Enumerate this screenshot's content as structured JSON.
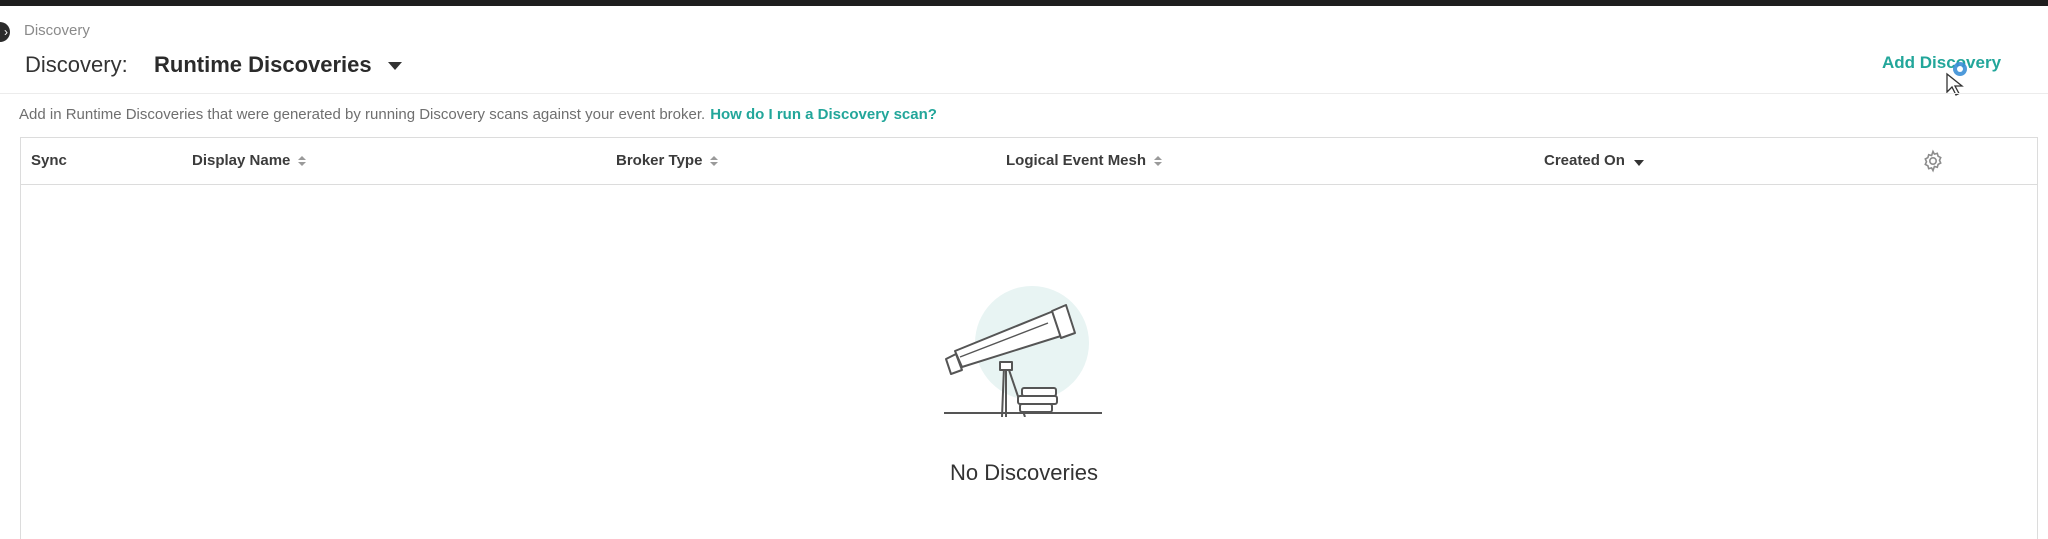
{
  "header": {
    "breadcrumb": "Discovery",
    "title_label": "Discovery:",
    "view_selected": "Runtime Discoveries",
    "add_button_label": "Add Discovery"
  },
  "info": {
    "text": "Add in Runtime Discoveries that were generated by running Discovery scans against your event broker.",
    "help_link": "How do I run a Discovery scan?"
  },
  "table": {
    "columns": [
      {
        "label": "Sync",
        "sortable": false
      },
      {
        "label": "Display Name",
        "sortable": true
      },
      {
        "label": "Broker Type",
        "sortable": true
      },
      {
        "label": "Logical Event Mesh",
        "sortable": true
      },
      {
        "label": "Created On",
        "sortable": true,
        "sort": "desc"
      }
    ],
    "settings_icon": "gear-icon"
  },
  "empty_state": {
    "illustration": "telescope-icon",
    "message": "No Discoveries"
  },
  "colors": {
    "accent": "#22a69a",
    "illustration_bg": "#e8f4f3",
    "top_bar": "#1e1e1e"
  }
}
